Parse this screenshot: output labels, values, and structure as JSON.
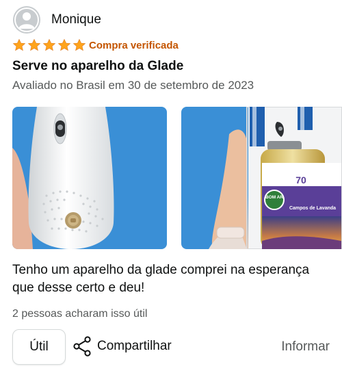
{
  "review": {
    "reviewer_name": "Monique",
    "rating": 5,
    "rating_max": 5,
    "verified_label": "Compra verificada",
    "title": "Serve no aparelho da Glade",
    "date_line": "Avaliado no Brasil em 30 de setembro de 2023",
    "body": "Tenho um aparelho da glade comprei na esperança que desse certo e deu!",
    "helpful_count_text": "2 pessoas acharam isso útil",
    "photos": [
      {
        "icon": "air-freshener-dispenser-photo"
      },
      {
        "icon": "air-freshener-refill-photo",
        "label_brand": "BOM AR",
        "label_badge": "70",
        "label_scent": "Campos de Lavanda"
      }
    ]
  },
  "actions": {
    "helpful_label": "Útil",
    "share_label": "Compartilhar",
    "report_label": "Informar"
  },
  "colors": {
    "star": "#ffa41c",
    "verified": "#c45500",
    "secondary_text": "#565959",
    "photo_background": "#3a8fd6"
  }
}
